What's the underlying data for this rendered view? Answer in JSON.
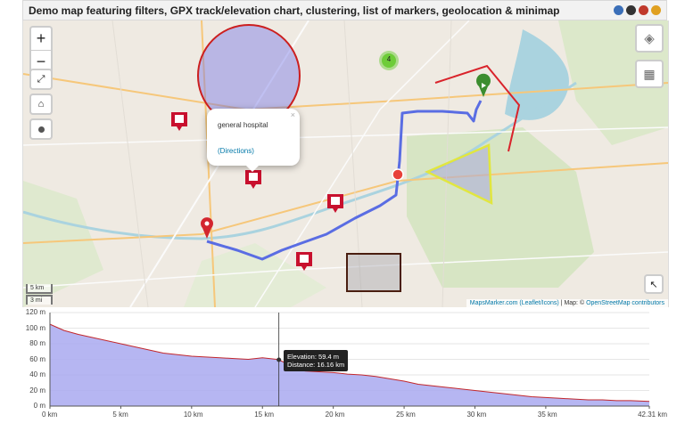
{
  "app": {
    "title": "Demo map featuring filters, GPX track/elevation chart, clustering, list of markers, geolocation & minimap"
  },
  "controls": {
    "zoom_in": "+",
    "zoom_out": "−"
  },
  "cluster": {
    "count": "4"
  },
  "popup": {
    "text": "general hospital",
    "link": "(Directions)",
    "close": "×"
  },
  "scale": {
    "km": "5 km",
    "mi": "3 mi"
  },
  "attribution": {
    "mapsmarker": "MapsMarker.com",
    "leaflet": "(Leaflet/Icons)",
    "sep": " | Map: © ",
    "osm": "OpenStreetMap contributors"
  },
  "colors": {
    "route": "#5a6de3",
    "circle": "#cc1f1f",
    "triangle": "#e1e63f",
    "polyline": "#d9232b",
    "rect_border": "#4a1e10",
    "elevation_fill": "#a9a9f0",
    "elevation_line": "#c2282d"
  },
  "chart": {
    "y_ticks": [
      "120 m",
      "100 m",
      "80 m",
      "60 m",
      "40 m",
      "20 m",
      "0 m"
    ],
    "x_ticks": [
      "0 km",
      "5 km",
      "10 km",
      "15 km",
      "20 km",
      "25 km",
      "30 km",
      "35 km",
      "42.31 km"
    ],
    "tooltip": {
      "elevation": "Elevation: 59.4 m",
      "distance": "Distance: 16.16 km"
    }
  },
  "chart_data": {
    "type": "area",
    "title": "",
    "xlabel": "",
    "ylabel": "",
    "xlim": [
      0,
      42.31
    ],
    "ylim": [
      0,
      120
    ],
    "x": [
      0,
      1,
      2,
      3,
      4,
      5,
      6,
      7,
      8,
      9,
      10,
      11,
      12,
      13,
      14,
      15,
      16,
      16.16,
      17,
      18,
      19,
      20,
      21,
      22,
      23,
      24,
      25,
      26,
      27,
      28,
      29,
      30,
      31,
      32,
      33,
      34,
      35,
      36,
      37,
      38,
      39,
      40,
      41,
      42.31
    ],
    "values": [
      105,
      97,
      92,
      88,
      84,
      80,
      76,
      72,
      68,
      66,
      64,
      63,
      62,
      61,
      60,
      62,
      60,
      59.4,
      52,
      45,
      44,
      43,
      41,
      40,
      38,
      35,
      32,
      28,
      26,
      24,
      22,
      20,
      18,
      16,
      14,
      12,
      11,
      10,
      9,
      8,
      8,
      7,
      7,
      6
    ]
  }
}
